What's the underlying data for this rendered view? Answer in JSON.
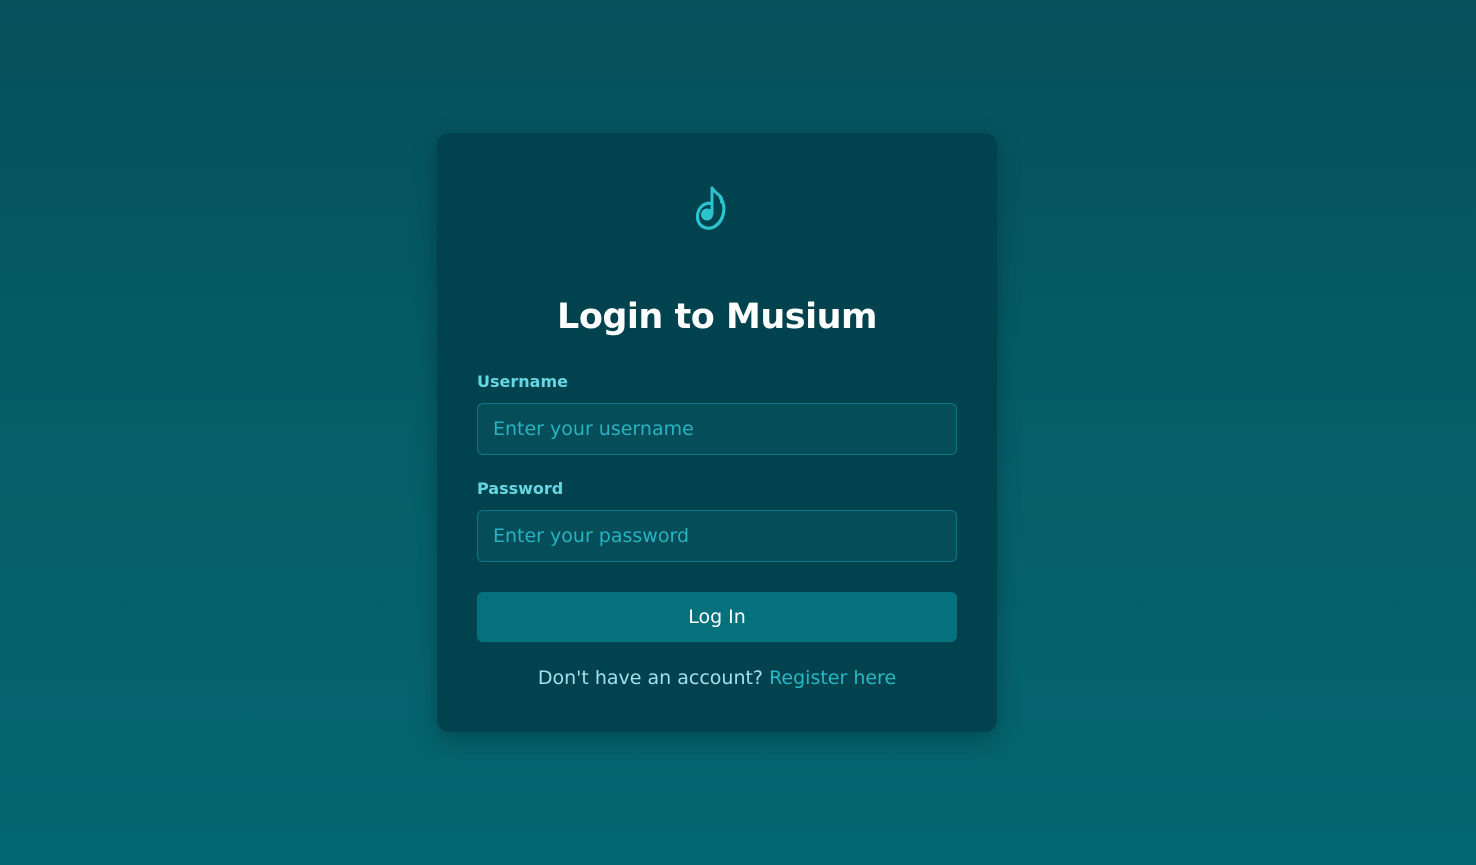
{
  "login_card": {
    "logo_icon": "music-note-icon",
    "title": "Login to Musium",
    "username": {
      "label": "Username",
      "placeholder": "Enter your username",
      "value": ""
    },
    "password": {
      "label": "Password",
      "placeholder": "Enter your password",
      "value": ""
    },
    "submit_label": "Log In",
    "footer": {
      "prompt": "Don't have an account?",
      "link_label": "Register here"
    }
  },
  "colors": {
    "background": "#05555f",
    "card": "#00434f",
    "accent": "#27b8c6",
    "label": "#66d7e2",
    "button": "#04717c"
  }
}
